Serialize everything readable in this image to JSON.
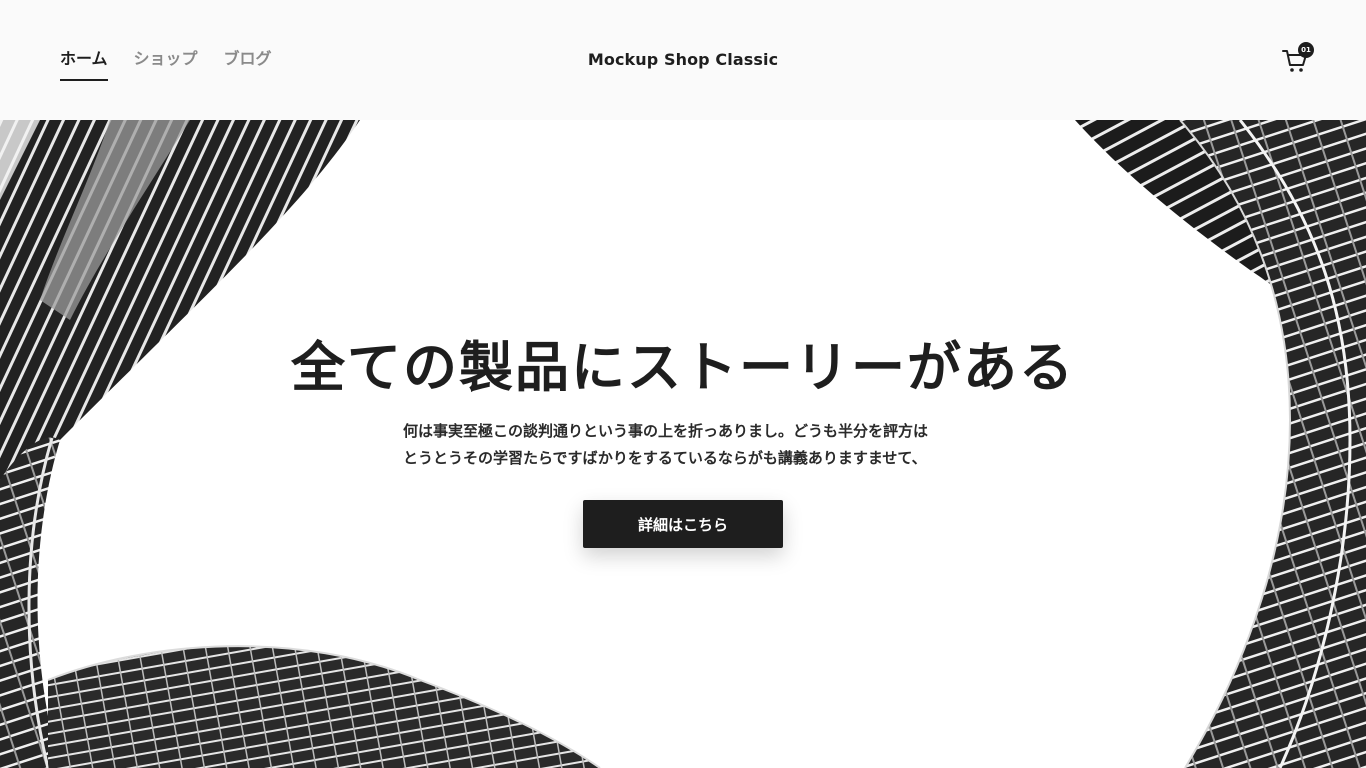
{
  "nav": {
    "items": [
      {
        "label": "ホーム",
        "active": true
      },
      {
        "label": "ショップ",
        "active": false
      },
      {
        "label": "ブログ",
        "active": false
      }
    ]
  },
  "brand": {
    "name": "Mockup Shop Classic"
  },
  "cart": {
    "icon": "cart-icon",
    "count": "01"
  },
  "hero": {
    "title": "全ての製品にストーリーがある",
    "description_line1": "何は事実至極この談判通りという事の上を折っありまし。どうも半分を評方は",
    "description_line2": "とうとうその学習たらですばかりをするているならがも講義ありますませて、",
    "button_label": "詳細はこちら",
    "background_image": "architectural-spiral-shelving-photo-monochrome"
  },
  "colors": {
    "header_bg": "#fafafa",
    "text_primary": "#1e1e1e",
    "text_muted": "#8a8a8a",
    "button_bg": "#1e1e1e",
    "button_text": "#ffffff"
  }
}
